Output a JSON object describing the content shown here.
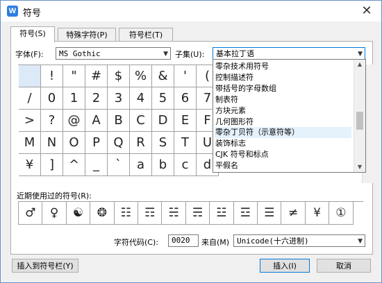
{
  "window": {
    "title": "符号",
    "app_icon": "W"
  },
  "tabs": [
    {
      "label": "符号(S)"
    },
    {
      "label": "特殊字符(P)"
    },
    {
      "label": "符号栏(T)"
    }
  ],
  "font": {
    "label": "字体(F):",
    "value": "MS Gothic"
  },
  "subset": {
    "label": "子集(U):",
    "value": "基本拉丁语"
  },
  "subset_options": [
    "零杂技术用符号",
    "控制描述符",
    "带括号的字母数组",
    "制表符",
    "方块元素",
    "几何图形符",
    "零杂丁贝符（示意符等）",
    "装饰标志",
    "CJK 符号和标点",
    "平假名"
  ],
  "subset_highlighted_index": 6,
  "symbols": [
    [
      "",
      "!",
      "\"",
      "#",
      "$",
      "%",
      "&",
      "'",
      "("
    ],
    [
      "/",
      "0",
      "1",
      "2",
      "3",
      "4",
      "5",
      "6",
      "7"
    ],
    [
      ">",
      "?",
      "@",
      "A",
      "B",
      "C",
      "D",
      "E",
      "F"
    ],
    [
      "M",
      "N",
      "O",
      "P",
      "Q",
      "R",
      "S",
      "T",
      "U"
    ],
    [
      "¥",
      "]",
      "^",
      "_",
      "`",
      "a",
      "b",
      "c",
      "d"
    ]
  ],
  "recent": {
    "label": "近期使用过的符号(R):",
    "symbols": [
      "♂",
      "♀",
      "☯",
      "❂",
      "☷",
      "☶",
      "☵",
      "☴",
      "☳",
      "☲",
      "☰",
      "≠",
      "¥",
      "①"
    ]
  },
  "char_code": {
    "label": "字符代码(C):",
    "value": "0020"
  },
  "from": {
    "label": "来自(M)",
    "value": "Unicode(十六进制)"
  },
  "buttons": {
    "insert_to_bar": "插入到符号栏(Y)",
    "insert": "插入(I)",
    "cancel": "取消"
  },
  "icons": {
    "close": "close-icon",
    "dropdown": "chevron-down-icon"
  },
  "colors": {
    "accent": "#0078d7",
    "selection": "#dce9f7",
    "app_icon": "#2f7fe0"
  }
}
